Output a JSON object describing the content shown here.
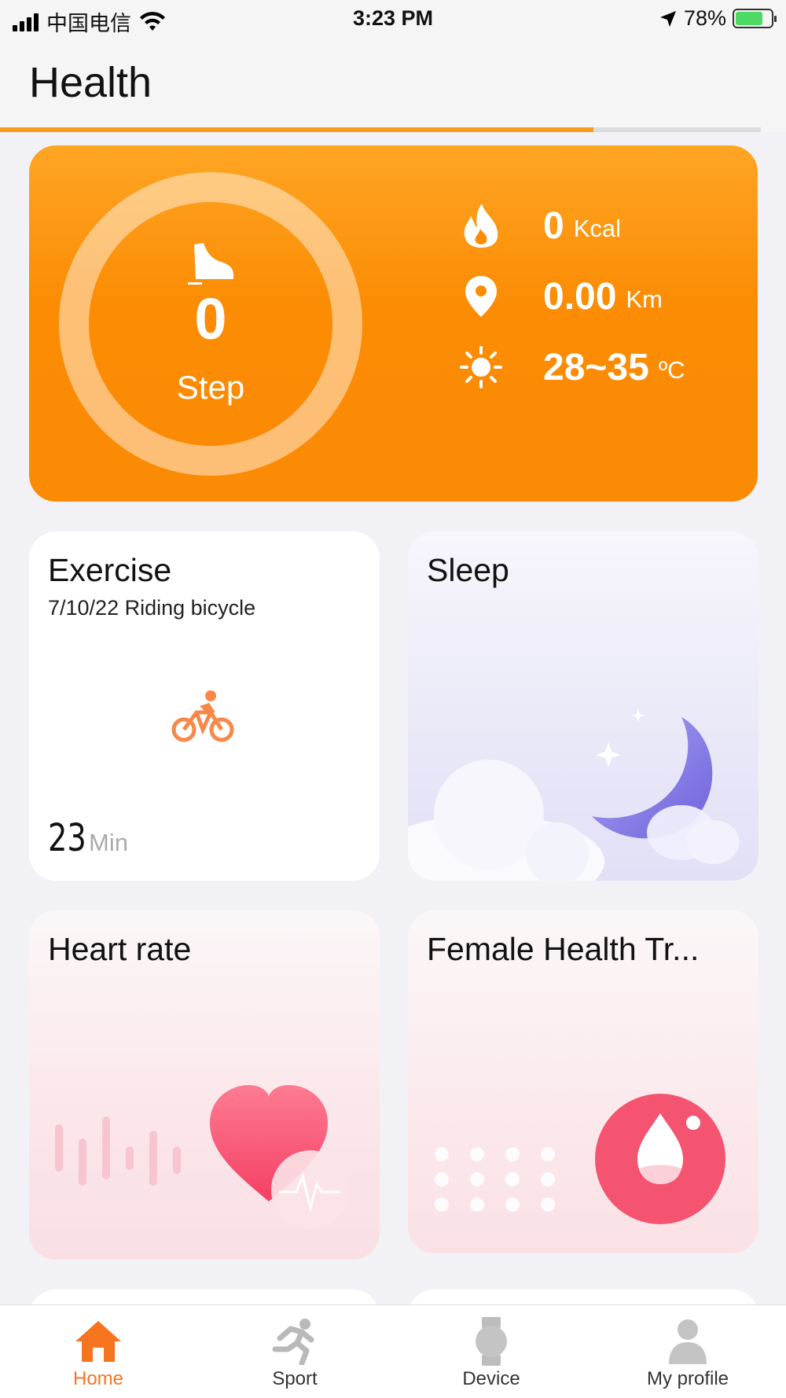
{
  "status_bar": {
    "carrier": "中国电信",
    "time": "3:23 PM",
    "battery": "78%"
  },
  "header": {
    "title": "Health",
    "progress_fraction": 0.78
  },
  "summary": {
    "steps_value": "0",
    "steps_label": "Step",
    "stats": [
      {
        "icon": "flame-icon",
        "value": "0",
        "unit": "Kcal"
      },
      {
        "icon": "location-pin-icon",
        "value": "0.00",
        "unit": "Km"
      },
      {
        "icon": "sun-icon",
        "value": "28~35",
        "unit": "ºC"
      }
    ]
  },
  "tiles": {
    "exercise": {
      "title": "Exercise",
      "subtitle": "7/10/22 Riding bicycle",
      "duration_value": "23",
      "duration_unit": "Min"
    },
    "sleep": {
      "title": "Sleep"
    },
    "heart_rate": {
      "title": "Heart rate"
    },
    "female_health": {
      "title": "Female Health Tr..."
    }
  },
  "tab_bar": {
    "tabs": [
      {
        "label": "Home",
        "icon": "home-icon",
        "active": true
      },
      {
        "label": "Sport",
        "icon": "running-person-icon",
        "active": false
      },
      {
        "label": "Device",
        "icon": "watch-icon",
        "active": false
      },
      {
        "label": "My profile",
        "icon": "person-icon",
        "active": false
      }
    ]
  },
  "colors": {
    "accent": "#f7741e",
    "card_orange": "#fb8c04",
    "heart_pink": "#f4546f"
  }
}
